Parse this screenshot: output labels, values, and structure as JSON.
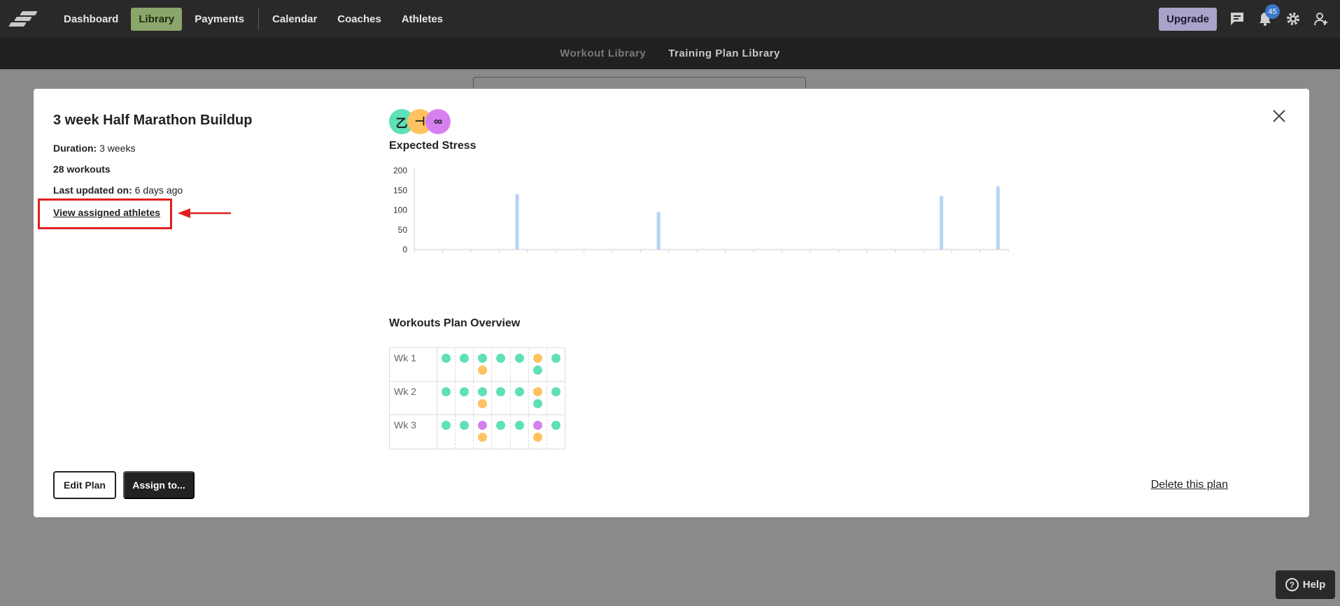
{
  "nav": {
    "items": [
      "Dashboard",
      "Library",
      "Payments",
      "Calendar",
      "Coaches",
      "Athletes"
    ],
    "upgrade_label": "Upgrade",
    "notification_count": "45"
  },
  "subnav": {
    "workout_library": "Workout Library",
    "training_plan_library": "Training Plan Library"
  },
  "plan": {
    "title": "3 week Half Marathon Buildup",
    "duration_label": "Duration:",
    "duration_value": "3 weeks",
    "workouts": "28 workouts",
    "last_updated_label": "Last updated on:",
    "last_updated_value": "6 days ago",
    "view_athletes": "View assigned athletes"
  },
  "sports": [
    {
      "icon": "run-icon",
      "glyph": "⼄",
      "color": "#5ee0b8"
    },
    {
      "icon": "strength-icon",
      "glyph": "⊣",
      "color": "#ffc260"
    },
    {
      "icon": "bike-icon",
      "glyph": "∞",
      "color": "#d680f0"
    }
  ],
  "stress_title": "Expected Stress",
  "overview_title": "Workouts Plan Overview",
  "chart_data": {
    "type": "bar",
    "yticks": [
      200,
      150,
      100,
      50,
      0
    ],
    "ylim": [
      0,
      200
    ],
    "bar_color": "#b8d2f4",
    "slots": 21,
    "values": [
      0,
      0,
      0,
      140,
      0,
      0,
      0,
      0,
      95,
      0,
      0,
      0,
      0,
      0,
      0,
      0,
      0,
      0,
      135,
      0,
      160
    ]
  },
  "weeks": [
    {
      "label": "Wk 1",
      "days": [
        [
          "teal"
        ],
        [
          "teal"
        ],
        [
          "teal",
          "orange"
        ],
        [
          "teal"
        ],
        [
          "teal"
        ],
        [
          "orange",
          "teal"
        ],
        [
          "teal"
        ]
      ]
    },
    {
      "label": "Wk 2",
      "days": [
        [
          "teal"
        ],
        [
          "teal"
        ],
        [
          "teal",
          "orange"
        ],
        [
          "teal"
        ],
        [
          "teal"
        ],
        [
          "orange",
          "teal"
        ],
        [
          "teal"
        ]
      ]
    },
    {
      "label": "Wk 3",
      "days": [
        [
          "teal"
        ],
        [
          "teal"
        ],
        [
          "purple",
          "orange"
        ],
        [
          "teal"
        ],
        [
          "teal"
        ],
        [
          "purple",
          "orange"
        ],
        [
          "teal"
        ]
      ]
    }
  ],
  "dot_colors": {
    "teal": "#5ee0b8",
    "orange": "#ffc260",
    "purple": "#d680f0"
  },
  "buttons": {
    "edit": "Edit Plan",
    "assign": "Assign to...",
    "delete": "Delete this plan"
  },
  "help_label": "Help"
}
